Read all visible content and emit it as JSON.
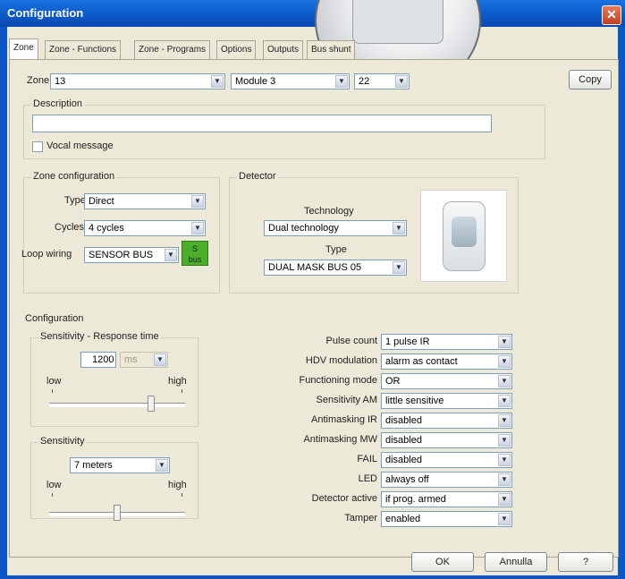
{
  "window": {
    "title": "Configuration",
    "close_glyph": "✕"
  },
  "tabs": [
    {
      "label": "Zone"
    },
    {
      "label": "Zone - Functions"
    },
    {
      "label": "Zone - Programs"
    },
    {
      "label": "Options"
    },
    {
      "label": "Outputs"
    },
    {
      "label": "Bus shunt"
    }
  ],
  "header": {
    "zone_label": "Zone",
    "zone_value": "13",
    "module_value": "Module 3",
    "module_num_value": "22",
    "copy_label": "Copy"
  },
  "description": {
    "title": "Description",
    "value": "",
    "vocal_label": "Vocal message"
  },
  "zone_config": {
    "title": "Zone configuration",
    "type_label": "Type",
    "type_value": "Direct",
    "cycles_label": "Cycles",
    "cycles_value": "4 cycles",
    "loop_label": "Loop wiring",
    "loop_value": "SENSOR BUS",
    "sbus_line1": "S",
    "sbus_line2": "bus"
  },
  "detector": {
    "title": "Detector",
    "technology_label": "Technology",
    "technology_value": "Dual technology",
    "type_label": "Type",
    "type_value": "DUAL MASK BUS 05"
  },
  "configuration": {
    "title": "Configuration",
    "sens_response_title": "Sensitivity - Response time",
    "response_value": "1200",
    "response_unit": "ms",
    "low_label": "low",
    "high_label": "high",
    "response_slider_level": 0.75,
    "sensitivity_title": "Sensitivity",
    "sensitivity_value": "7 meters",
    "sensitivity_slider_level": 0.5,
    "fields": [
      {
        "label": "Pulse count",
        "value": "1 pulse IR"
      },
      {
        "label": "HDV modulation",
        "value": "alarm as contact"
      },
      {
        "label": "Functioning mode",
        "value": "OR"
      },
      {
        "label": "Sensitivity AM",
        "value": "little sensitive"
      },
      {
        "label": "Antimasking IR",
        "value": "disabled"
      },
      {
        "label": "Antimasking MW",
        "value": "disabled"
      },
      {
        "label": "FAIL",
        "value": "disabled"
      },
      {
        "label": "LED",
        "value": "always off"
      },
      {
        "label": "Detector active",
        "value": "if prog. armed"
      },
      {
        "label": "Tamper",
        "value": "enabled"
      }
    ]
  },
  "footer": {
    "ok_label": "OK",
    "cancel_label": "Annulla",
    "help_label": "?"
  },
  "colors": {
    "titlebar": "#0b57c6",
    "dialog_bg": "#ece9d8",
    "sbus_green": "#4caf2b"
  }
}
